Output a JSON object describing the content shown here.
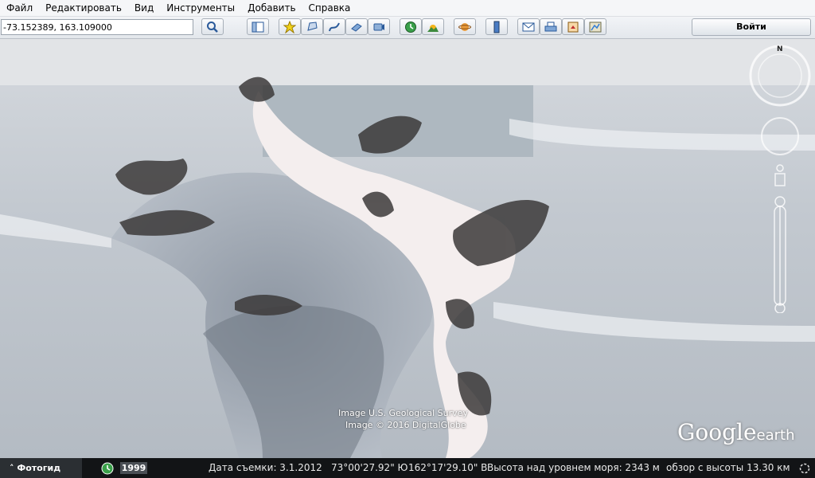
{
  "menu": {
    "items": [
      "Файл",
      "Редактировать",
      "Вид",
      "Инструменты",
      "Добавить",
      "Справка"
    ]
  },
  "toolbar": {
    "search_value": "-73.152389, 163.109000",
    "login_label": "Войти",
    "icons": [
      "search-icon",
      "sidebar-icon",
      "placemark-icon",
      "polygon-icon",
      "path-icon",
      "overlay-icon",
      "tour-icon",
      "historical-imagery-icon",
      "sunlight-icon",
      "planets-icon",
      "ruler-icon",
      "email-icon",
      "print-icon",
      "save-image-icon",
      "maps-icon"
    ]
  },
  "map": {
    "credit_line1": "Image U.S. Geological Survey",
    "credit_line2": "Image © 2016 DigitalGlobe",
    "logo_google": "Google",
    "logo_earth": "earth",
    "compass_label": "N"
  },
  "statusbar": {
    "photo_tab": "Фотогид",
    "year": "1999",
    "imagery_date": "Дата съемки: 3.1.2012",
    "latitude": "73°00'27.92\" Ю",
    "longitude": "162°17'29.10\" В",
    "elevation": "Высота над уровнем моря:  2343 м",
    "eye_altitude": "обзор с высоты  13.30 км"
  },
  "colors": {
    "accent": "#2f7bd6",
    "status_bg": "#121416"
  }
}
